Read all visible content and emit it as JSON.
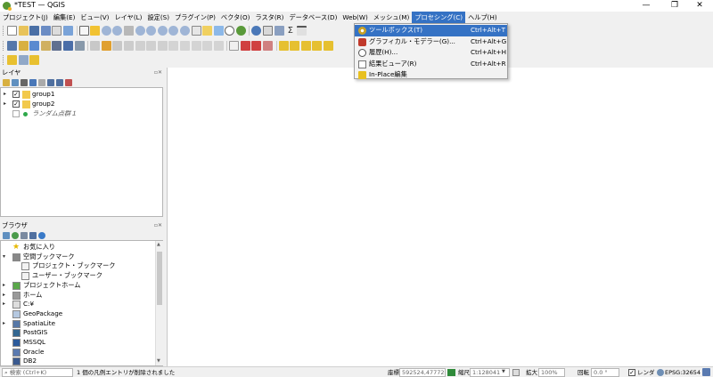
{
  "window": {
    "title": "*TEST — QGIS",
    "minimize": "—",
    "restore": "❐",
    "close": "✕"
  },
  "menu": [
    "プロジェクト(J)",
    "編集(E)",
    "ビュー(V)",
    "レイヤ(L)",
    "設定(S)",
    "プラグイン(P)",
    "ベクタ(O)",
    "ラスタ(R)",
    "データベース(D)",
    "Web(W)",
    "メッシュ(M)",
    "プロセシング(C)",
    "ヘルプ(H)"
  ],
  "active_menu_index": 11,
  "processing_menu": [
    {
      "label": "ツールボックス(T)",
      "shortcut": "Ctrl+Alt+T",
      "icon": "gear-icon",
      "highlighted": true
    },
    {
      "label": "グラフィカル・モデラー(G)...",
      "shortcut": "Ctrl+Alt+G",
      "icon": "model-icon",
      "highlighted": false
    },
    {
      "label": "履歴(H)...",
      "shortcut": "Ctrl+Alt+H",
      "icon": "history-icon",
      "highlighted": false
    },
    {
      "label": "結果ビューア(R)",
      "shortcut": "Ctrl+Alt+R",
      "icon": "results-icon",
      "highlighted": false
    },
    {
      "label": "In-Place編集",
      "shortcut": "",
      "icon": "inplace-icon",
      "highlighted": false
    }
  ],
  "layers_panel": {
    "title": "レイヤ",
    "dock": "▫✕",
    "items": [
      {
        "label": "group1",
        "checked": true,
        "expanded": false,
        "italic": false
      },
      {
        "label": "group2",
        "checked": true,
        "expanded": false,
        "italic": false
      },
      {
        "label": "ランダム点群１",
        "checked": false,
        "expanded": false,
        "italic": true
      }
    ]
  },
  "browser_panel": {
    "title": "ブラウザ",
    "dock": "▫✕",
    "items": [
      {
        "label": "お気に入り",
        "level": 0,
        "arrow": "",
        "icon": "star-icon"
      },
      {
        "label": "空間ブックマーク",
        "level": 0,
        "arrow": "▾",
        "icon": "bookmark-icon"
      },
      {
        "label": "プロジェクト・ブックマーク",
        "level": 1,
        "arrow": "",
        "icon": "folder-icon"
      },
      {
        "label": "ユーザー・ブックマーク",
        "level": 1,
        "arrow": "",
        "icon": "folder-icon"
      },
      {
        "label": "プロジェクトホーム",
        "level": 0,
        "arrow": "▸",
        "icon": "project-home-icon"
      },
      {
        "label": "ホーム",
        "level": 0,
        "arrow": "▸",
        "icon": "home-icon"
      },
      {
        "label": "C:¥",
        "level": 0,
        "arrow": "▸",
        "icon": "drive-icon"
      },
      {
        "label": "GeoPackage",
        "level": 0,
        "arrow": "",
        "icon": "geopackage-icon"
      },
      {
        "label": "SpatiaLite",
        "level": 0,
        "arrow": "▸",
        "icon": "spatialite-icon"
      },
      {
        "label": "PostGIS",
        "level": 0,
        "arrow": "",
        "icon": "postgis-icon"
      },
      {
        "label": "MSSQL",
        "level": 0,
        "arrow": "",
        "icon": "mssql-icon"
      },
      {
        "label": "Oracle",
        "level": 0,
        "arrow": "",
        "icon": "oracle-icon"
      },
      {
        "label": "DB2",
        "level": 0,
        "arrow": "",
        "icon": "db2-icon"
      }
    ]
  },
  "statusbar": {
    "search_placeholder": "検索 (Ctrl+K)",
    "message": "1 個の凡例エントリが削除されました",
    "coord_label": "座標",
    "coord_value": "592524,4777207",
    "scale_label": "縮尺",
    "scale_value": "1:128041",
    "magnifier_label": "拡大",
    "magnifier_value": "100%",
    "rotation_label": "回転",
    "rotation_value": "0.0 °",
    "render_label": "レンダ",
    "crs": "EPSG:32654"
  },
  "colors": {
    "accent": "#3572c4",
    "qgis_green": "#589632"
  }
}
